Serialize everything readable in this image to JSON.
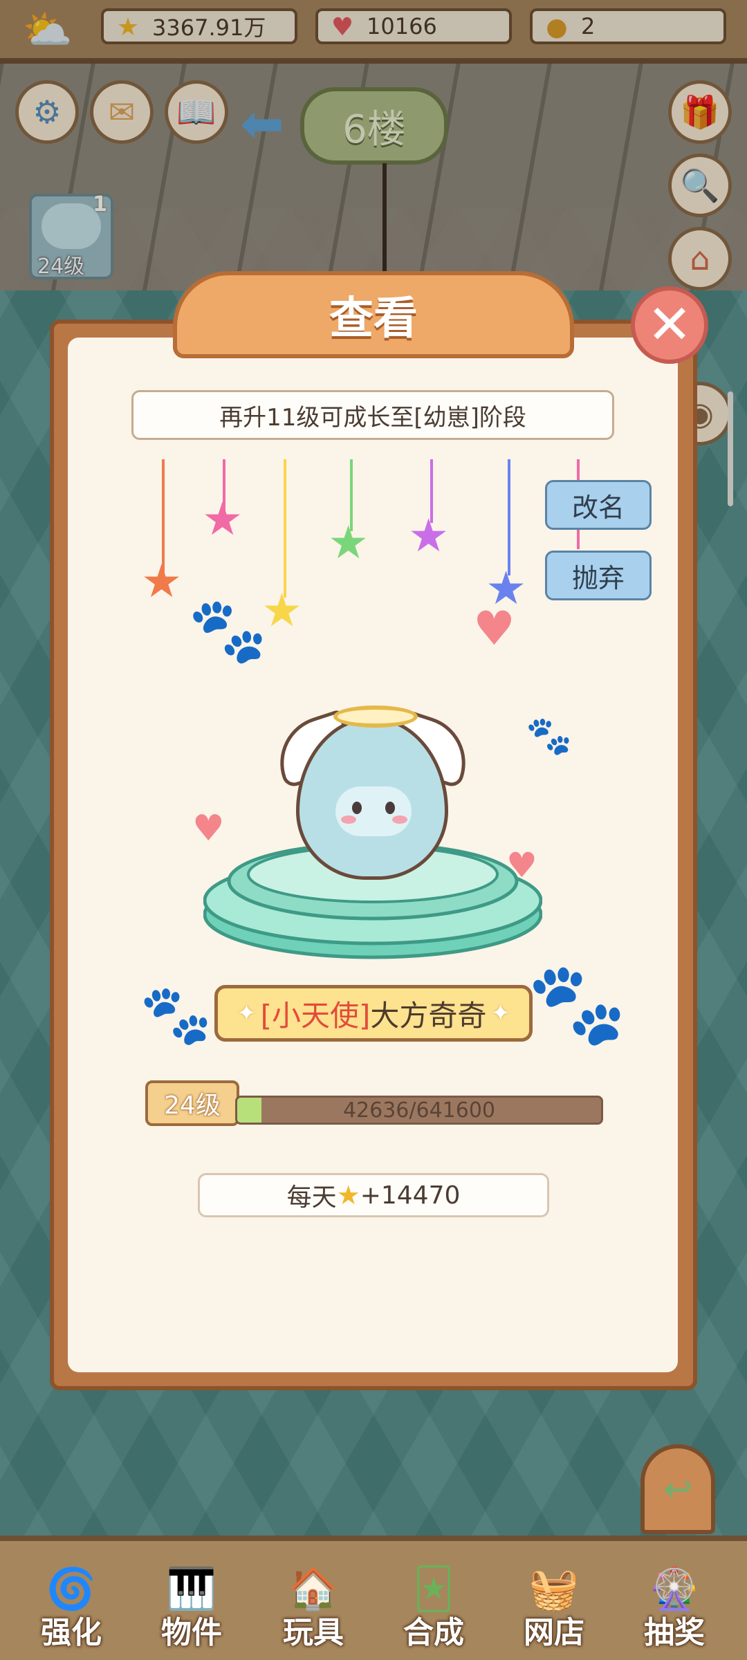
{
  "top_bar": {
    "stars": "3367.91万",
    "hearts": "10166",
    "coins": "2"
  },
  "hud": {
    "floor_sign": "6楼",
    "pet_level_badge": "24级",
    "pet_badge_count": "1"
  },
  "modal": {
    "title": "查看",
    "close_icon": "close-icon",
    "growth_hint": "再升11级可成长至[幼崽]阶段",
    "rename_label": "改名",
    "abandon_label": "抛弃",
    "pet_name_prefix": "[小天使]",
    "pet_name": "大方奇奇",
    "level_label": "24级",
    "xp_text": "42636/641600",
    "xp_progress": 0.066,
    "daily_prefix": "每天",
    "daily_value": "+14470"
  },
  "colors": {
    "accent_orange": "#eea867",
    "modal_frame": "#b97746",
    "button_blue": "#a9d0ec",
    "name_red": "#e24b3a"
  },
  "bottom_nav": [
    {
      "label": "强化",
      "icon": "swirl-icon"
    },
    {
      "label": "物件",
      "icon": "piano-icon"
    },
    {
      "label": "玩具",
      "icon": "house-toy-icon"
    },
    {
      "label": "合成",
      "icon": "merge-icon"
    },
    {
      "label": "网店",
      "icon": "basket-icon"
    },
    {
      "label": "抽奖",
      "icon": "wheel-icon"
    }
  ]
}
